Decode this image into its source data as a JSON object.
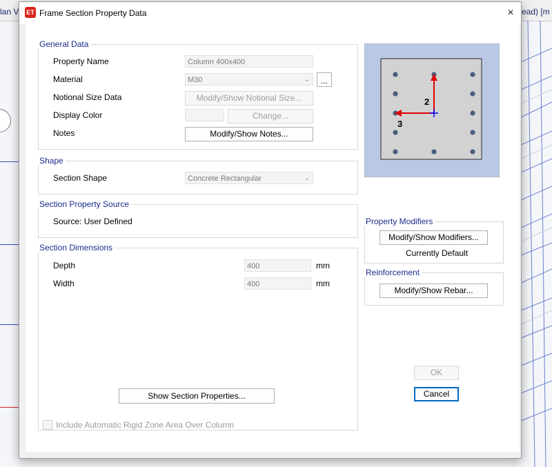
{
  "background": {
    "left_title": "lan Vi",
    "right_title": "ead)  [m"
  },
  "dialog": {
    "app_icon": "ET",
    "title": "Frame Section Property Data",
    "close_icon": "×"
  },
  "general_data": {
    "legend": "General Data",
    "property_name_label": "Property Name",
    "property_name_value": "Column 400x400",
    "material_label": "Material",
    "material_value": "M30",
    "material_more": "...",
    "notional_size_label": "Notional Size Data",
    "notional_size_button": "Modify/Show Notional Size...",
    "display_color_label": "Display Color",
    "change_button": "Change...",
    "notes_label": "Notes",
    "notes_button": "Modify/Show Notes..."
  },
  "shape": {
    "legend": "Shape",
    "section_shape_label": "Section Shape",
    "section_shape_value": "Concrete Rectangular"
  },
  "source": {
    "legend": "Section Property Source",
    "text": "Source:  User Defined"
  },
  "dimensions": {
    "legend": "Section Dimensions",
    "depth_label": "Depth",
    "depth_value": "400",
    "depth_unit": "mm",
    "width_label": "Width",
    "width_value": "400",
    "width_unit": "mm"
  },
  "preview": {
    "axis_2_label": "2",
    "axis_3_label": "3"
  },
  "property_modifiers": {
    "legend": "Property Modifiers",
    "button": "Modify/Show Modifiers...",
    "status": "Currently Default"
  },
  "reinforcement": {
    "legend": "Reinforcement",
    "button": "Modify/Show Rebar..."
  },
  "actions": {
    "show_properties": "Show Section Properties...",
    "ok": "OK",
    "cancel": "Cancel",
    "rigid_zone_checkbox": "Include Automatic Rigid Zone Area Over Column"
  },
  "colors": {
    "legend_text": "#1b2b8c",
    "rebar_dot": "#4a5d7e",
    "axis_red": "#e00000",
    "axis_blue": "#0000ff",
    "preview_bg": "#b9c9e4"
  }
}
